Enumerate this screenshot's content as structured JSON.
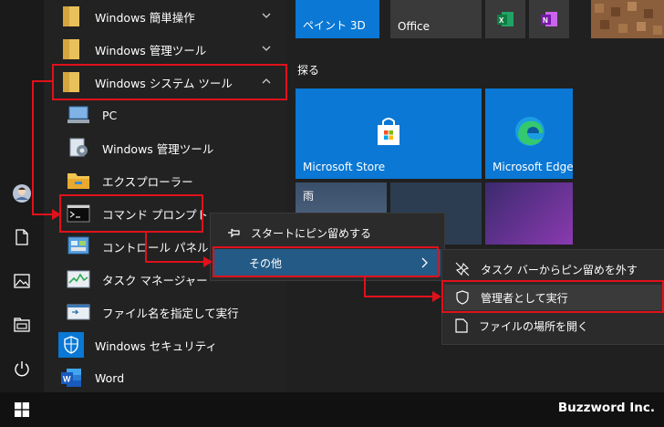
{
  "app_list": {
    "items": [
      {
        "label": "Windows 簡単操作",
        "icon": "folder-icon",
        "chevron": "chevron-down-icon"
      },
      {
        "label": "Windows 管理ツール",
        "icon": "folder-icon",
        "chevron": "chevron-down-icon"
      },
      {
        "label": "Windows システム ツール",
        "icon": "folder-icon",
        "chevron": "chevron-up-icon"
      },
      {
        "label": "PC",
        "icon": "pc-icon"
      },
      {
        "label": "Windows 管理ツール",
        "icon": "admin-tools-icon"
      },
      {
        "label": "エクスプローラー",
        "icon": "file-explorer-icon"
      },
      {
        "label": "コマンド プロンプト",
        "icon": "command-prompt-icon"
      },
      {
        "label": "コントロール パネル",
        "icon": "control-panel-icon"
      },
      {
        "label": "タスク マネージャー",
        "icon": "task-manager-icon"
      },
      {
        "label": "ファイル名を指定して実行",
        "icon": "run-icon"
      },
      {
        "label": "Windows セキュリティ",
        "icon": "windows-security-icon"
      },
      {
        "label": "Word",
        "icon": "word-icon"
      }
    ]
  },
  "tiles": {
    "top_row": [
      {
        "label": "ペイント 3D",
        "icon": "paint3d-icon"
      },
      {
        "label": "Office",
        "icon": "office-icon"
      },
      {
        "label": "",
        "icon": "excel-icon"
      },
      {
        "label": "",
        "icon": "onenote-icon"
      },
      {
        "label": "",
        "icon": "minecraft-icon"
      }
    ],
    "section_label": "探る",
    "store": {
      "label": "Microsoft Store",
      "icon": "store-icon"
    },
    "edge": {
      "label": "Microsoft Edge",
      "icon": "edge-icon"
    },
    "weather": {
      "label": "雨",
      "icon": "weather-icon"
    }
  },
  "context_menu": {
    "pin_start": {
      "label": "スタートにピン留めする",
      "icon": "pin-icon"
    },
    "more": {
      "label": "その他",
      "icon": "chevron-right-icon"
    }
  },
  "submenu": {
    "items": [
      {
        "label": "タスク バーからピン留めを外す",
        "icon": "unpin-icon"
      },
      {
        "label": "管理者として実行",
        "icon": "shield-icon"
      },
      {
        "label": "ファイルの場所を開く",
        "icon": "open-location-icon"
      }
    ]
  },
  "rail": {
    "icons": [
      "user-avatar",
      "document-icon",
      "pictures-icon",
      "file-explorer-icon",
      "power-icon"
    ]
  },
  "taskbar": {
    "start_icon": "windows-start-icon"
  },
  "watermark": "Buzzword Inc.",
  "colors": {
    "highlight": "#e0111b",
    "tile_blue": "#0a78d4",
    "hover_blue": "#245a86"
  }
}
